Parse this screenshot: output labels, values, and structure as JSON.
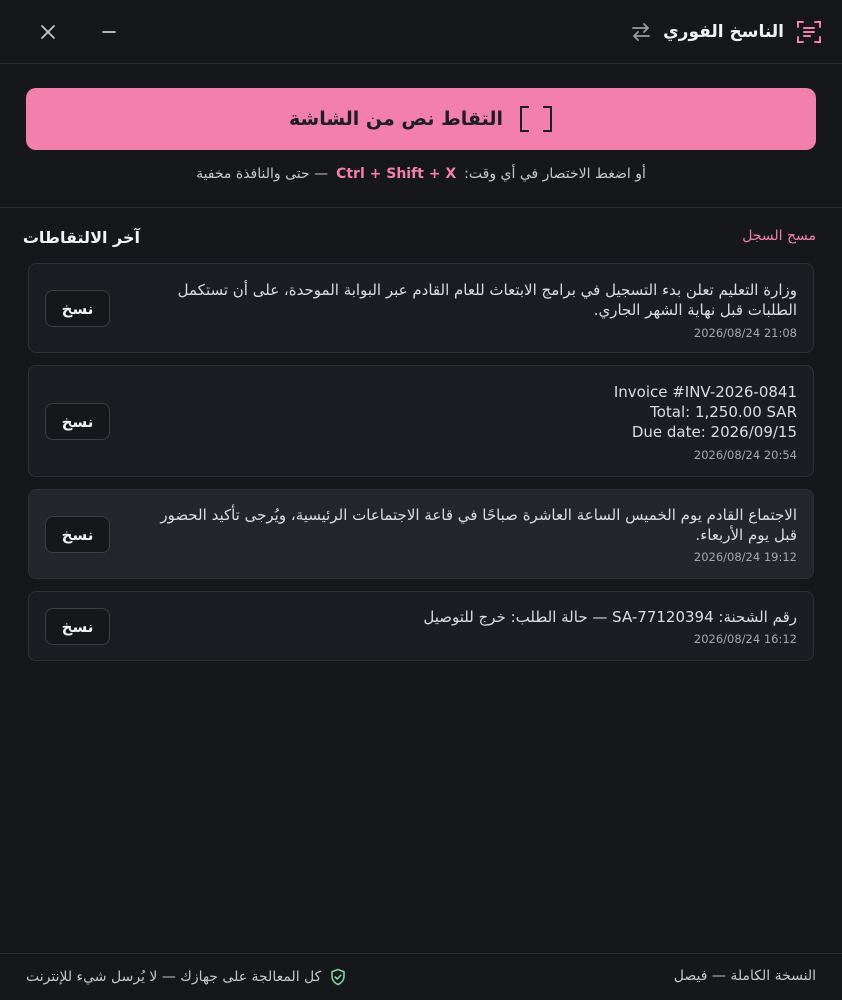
{
  "app": {
    "title": "الناسخ الفوري"
  },
  "capture": {
    "label": "التقاط نص من الشاشة",
    "hint_before": "أو اضغط الاختصار في أي وقت:",
    "shortcut": "Ctrl + Shift + X",
    "hint_after": "— حتى والنافذة مخفية"
  },
  "history": {
    "title": "آخر الالتقاطات",
    "clear_label": "مسح السجل",
    "copy_label": "نسخ",
    "items": [
      {
        "text": "وزارة التعليم تعلن بدء التسجيل في برامج الابتعاث للعام القادم عبر البوابة الموحدة، على أن تستكمل الطلبات قبل نهاية الشهر الجاري.",
        "time": "2026/08/24 21:08"
      },
      {
        "lines": [
          "Invoice #INV-2026-0841",
          "Total: 1,250.00 SAR",
          "Due date: 2026/09/15"
        ],
        "time": "2026/08/24 20:54"
      },
      {
        "text": "الاجتماع القادم يوم الخميس الساعة العاشرة صباحًا في قاعة الاجتماعات الرئيسية، ويُرجى تأكيد الحضور قبل يوم الأربعاء.",
        "time": "2026/08/24 19:12"
      },
      {
        "text": "رقم الشحنة: SA-77120394 — حالة الطلب: خرج للتوصيل",
        "time": "2026/08/24 16:12"
      }
    ]
  },
  "footer": {
    "privacy": "كل المعالجة على جهازك — لا يُرسل شيء للإنترنت",
    "edition": "النسخة الكاملة — فيصل"
  },
  "colors": {
    "accent": "#f27fac",
    "background": "#16171b",
    "card": "#1c1d22",
    "card_active": "#25262d",
    "shield": "#7fd6a0"
  }
}
